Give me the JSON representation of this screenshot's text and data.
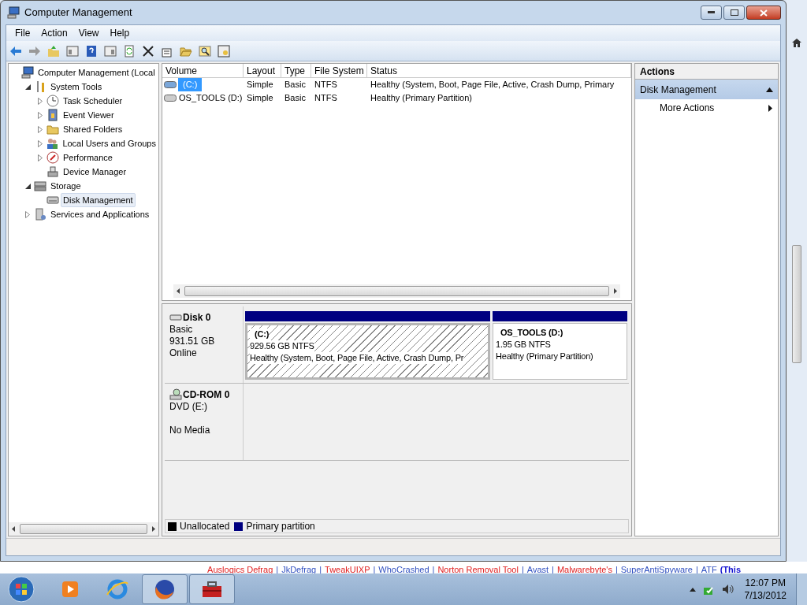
{
  "window": {
    "title": "Computer Management"
  },
  "menu": [
    "File",
    "Action",
    "View",
    "Help"
  ],
  "tree": [
    {
      "label": "Computer Management (Local",
      "kind": "computer",
      "selected": false,
      "children": [
        {
          "label": "System Tools",
          "kind": "tools",
          "expanded": true,
          "selected": false,
          "children": [
            {
              "label": "Task Scheduler",
              "kind": "clock",
              "expanded": false,
              "selected": false
            },
            {
              "label": "Event Viewer",
              "kind": "log",
              "expanded": false,
              "selected": false
            },
            {
              "label": "Shared Folders",
              "kind": "folder",
              "expanded": false,
              "selected": false
            },
            {
              "label": "Local Users and Groups",
              "kind": "users",
              "expanded": false,
              "selected": false
            },
            {
              "label": "Performance",
              "kind": "gauge",
              "expanded": false,
              "selected": false
            },
            {
              "label": "Device Manager",
              "kind": "device",
              "selected": false
            }
          ]
        },
        {
          "label": "Storage",
          "kind": "storage",
          "expanded": true,
          "selected": false,
          "children": [
            {
              "label": "Disk Management",
              "kind": "disk",
              "selected": true
            }
          ]
        },
        {
          "label": "Services and Applications",
          "kind": "services",
          "expanded": false,
          "selected": false
        }
      ]
    }
  ],
  "volumes": {
    "columns": [
      "Volume",
      "Layout",
      "Type",
      "File System",
      "Status"
    ],
    "rows": [
      {
        "cells": [
          "(C:)",
          "Simple",
          "Basic",
          "NTFS",
          "Healthy (System, Boot, Page File, Active, Crash Dump, Primary"
        ],
        "selected": true
      },
      {
        "cells": [
          "OS_TOOLS (D:)",
          "Simple",
          "Basic",
          "NTFS",
          "Healthy (Primary Partition)"
        ],
        "selected": false
      }
    ]
  },
  "disks": [
    {
      "name": "Disk 0",
      "kind": "disk",
      "lines": [
        "Basic",
        "931.51 GB",
        "Online"
      ],
      "partitions": [
        {
          "name": "(C:)",
          "size": "929.56 GB NTFS",
          "status": "Healthy (System, Boot, Page File, Active, Crash Dump, Pr",
          "selected": true,
          "color": "#000080"
        },
        {
          "name": "OS_TOOLS  (D:)",
          "size": "1.95 GB NTFS",
          "status": "Healthy (Primary Partition)",
          "selected": false,
          "color": "#000080"
        }
      ]
    },
    {
      "name": "CD-ROM 0",
      "kind": "cdrom",
      "lines": [
        "DVD (E:)",
        "No Media"
      ]
    }
  ],
  "legend": [
    {
      "label": "Unallocated",
      "color": "#000000"
    },
    {
      "label": "Primary partition",
      "color": "#000080"
    }
  ],
  "actions": {
    "title": "Actions",
    "section": "Disk Management",
    "expanded": true,
    "items": [
      "More Actions"
    ]
  },
  "background_links": [
    {
      "kind": "link",
      "text": "Auslogics Defrag",
      "color": "#e02020"
    },
    {
      "kind": "separator",
      "text": "|"
    },
    {
      "kind": "link",
      "text": "JkDefrag",
      "color": "#3050c0"
    },
    {
      "kind": "separator",
      "text": "|"
    },
    {
      "kind": "link",
      "text": "TweakUIXP",
      "color": "#e02020"
    },
    {
      "kind": "separator",
      "text": "|"
    },
    {
      "kind": "link",
      "text": "WhoCrashed",
      "color": "#3050c0"
    },
    {
      "kind": "separator",
      "text": "|"
    },
    {
      "kind": "link",
      "text": "Norton Removal Tool",
      "color": "#e02020"
    },
    {
      "kind": "separator",
      "text": "|"
    },
    {
      "kind": "link",
      "text": "Avast",
      "color": "#3050c0"
    },
    {
      "kind": "separator",
      "text": "|"
    },
    {
      "kind": "link",
      "text": "Malwarebyte's",
      "color": "#e02020"
    },
    {
      "kind": "separator",
      "text": "|"
    },
    {
      "kind": "link",
      "text": "SuperAntiSpyware",
      "color": "#3050c0"
    },
    {
      "kind": "separator",
      "text": "|"
    },
    {
      "kind": "link",
      "text": "ATF",
      "color": "#3050c0"
    },
    {
      "kind": "link",
      "text": "(This",
      "color": "#1010d0"
    }
  ],
  "taskbar": {
    "apps": [
      {
        "kind": "media",
        "active": false
      },
      {
        "kind": "browser-e",
        "active": false
      },
      {
        "kind": "fox",
        "active": true
      },
      {
        "kind": "toolbox",
        "active": true
      }
    ],
    "time": "12:07 PM",
    "date": "7/13/2012"
  }
}
